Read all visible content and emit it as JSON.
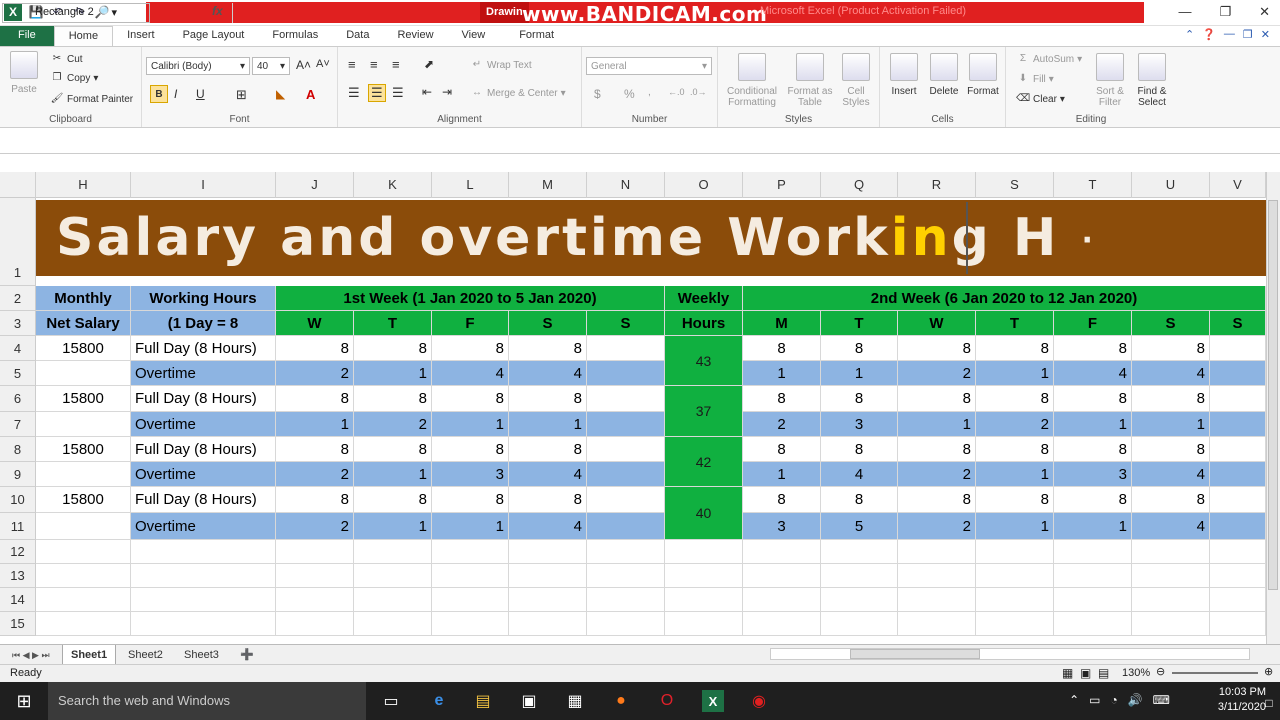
{
  "titlebar": {
    "drawing_tab": "Drawin",
    "watermark": "www.BANDICAM.com",
    "app_title": "Microsoft Excel (Product Activation Failed)"
  },
  "tabs": [
    "File",
    "Home",
    "Insert",
    "Page Layout",
    "Formulas",
    "Data",
    "Review",
    "View",
    "Format"
  ],
  "ribbon": {
    "clipboard": {
      "paste": "Paste",
      "cut": "Cut",
      "copy": "Copy",
      "format_painter": "Format Painter",
      "label": "Clipboard"
    },
    "font": {
      "name": "Calibri (Body)",
      "size": "40",
      "bold": "B",
      "italic": "I",
      "underline": "U",
      "label": "Font"
    },
    "alignment": {
      "wrap": "Wrap Text",
      "merge": "Merge & Center",
      "label": "Alignment"
    },
    "number": {
      "format": "General",
      "dollar": "$",
      "percent": "%",
      "label": "Number"
    },
    "styles": {
      "conditional": "Conditional Formatting",
      "format_table": "Format as Table",
      "cell_styles": "Cell Styles",
      "label": "Styles"
    },
    "cells": {
      "insert": "Insert",
      "delete": "Delete",
      "format": "Format",
      "label": "Cells"
    },
    "editing": {
      "autosum": "AutoSum",
      "fill": "Fill",
      "clear": "Clear",
      "sort": "Sort & Filter",
      "find": "Find & Select",
      "label": "Editing"
    }
  },
  "formula_bar": {
    "name_box": "Rectangle 2",
    "fx": "fx",
    "value": ""
  },
  "columns": [
    "H",
    "I",
    "J",
    "K",
    "L",
    "M",
    "N",
    "O",
    "P",
    "Q",
    "R",
    "S",
    "T",
    "U",
    "V"
  ],
  "rows": [
    "1",
    "2",
    "3",
    "4",
    "5",
    "6",
    "7",
    "8",
    "9",
    "10",
    "11",
    "12",
    "13",
    "14",
    "15"
  ],
  "sheet": {
    "title_pre": "Salary and overtime Work",
    "title_hl": "in",
    "title_post": "g H",
    "title_dot": "·",
    "hdr_monthly_1": "Monthly",
    "hdr_monthly_2": "Net Salary",
    "hdr_working_1": "Working Hours",
    "hdr_working_2": "(1 Day = 8",
    "hdr_week1": "1st Week (1 Jan 2020 to 5 Jan 2020)",
    "hdr_weekly_1": "Weekly",
    "hdr_weekly_2": "Hours",
    "hdr_week2": "2nd Week (6 Jan 2020 to 12 Jan 2020)",
    "week1_days": [
      "W",
      "T",
      "F",
      "S",
      "S"
    ],
    "week2_days": [
      "M",
      "T",
      "W",
      "T",
      "F",
      "S",
      "S"
    ],
    "employees": [
      {
        "salary": "15800",
        "full": "Full Day (8 Hours)",
        "ot": "Overtime",
        "w1_full": [
          "8",
          "8",
          "8",
          "8",
          ""
        ],
        "w1_ot": [
          "2",
          "1",
          "4",
          "4",
          ""
        ],
        "weekly": "43",
        "w2_full": [
          "8",
          "8",
          "8",
          "8",
          "8",
          "8",
          ""
        ],
        "w2_ot": [
          "1",
          "1",
          "2",
          "1",
          "4",
          "4",
          ""
        ]
      },
      {
        "salary": "15800",
        "full": "Full Day (8 Hours)",
        "ot": "Overtime",
        "w1_full": [
          "8",
          "8",
          "8",
          "8",
          ""
        ],
        "w1_ot": [
          "1",
          "2",
          "1",
          "1",
          ""
        ],
        "weekly": "37",
        "w2_full": [
          "8",
          "8",
          "8",
          "8",
          "8",
          "8",
          ""
        ],
        "w2_ot": [
          "2",
          "3",
          "1",
          "2",
          "1",
          "1",
          ""
        ]
      },
      {
        "salary": "15800",
        "full": "Full Day (8 Hours)",
        "ot": "Overtime",
        "w1_full": [
          "8",
          "8",
          "8",
          "8",
          ""
        ],
        "w1_ot": [
          "2",
          "1",
          "3",
          "4",
          ""
        ],
        "weekly": "42",
        "w2_full": [
          "8",
          "8",
          "8",
          "8",
          "8",
          "8",
          ""
        ],
        "w2_ot": [
          "1",
          "4",
          "2",
          "1",
          "3",
          "4",
          ""
        ]
      },
      {
        "salary": "15800",
        "full": "Full Day (8 Hours)",
        "ot": "Overtime",
        "w1_full": [
          "8",
          "8",
          "8",
          "8",
          ""
        ],
        "w1_ot": [
          "2",
          "1",
          "1",
          "4",
          ""
        ],
        "weekly": "40",
        "w2_full": [
          "8",
          "8",
          "8",
          "8",
          "8",
          "8",
          ""
        ],
        "w2_ot": [
          "3",
          "5",
          "2",
          "1",
          "1",
          "4",
          ""
        ]
      }
    ]
  },
  "sheet_tabs": [
    "Sheet1",
    "Sheet2",
    "Sheet3"
  ],
  "status": {
    "ready": "Ready",
    "zoom": "130%"
  },
  "taskbar": {
    "search": "Search the web and Windows",
    "time": "10:03 PM",
    "date": "3/11/2020"
  },
  "colors": {
    "green": "#10b040",
    "blue": "#8db4e2",
    "title_bg": "#8b4c0a",
    "excel_green": "#1e7145"
  }
}
